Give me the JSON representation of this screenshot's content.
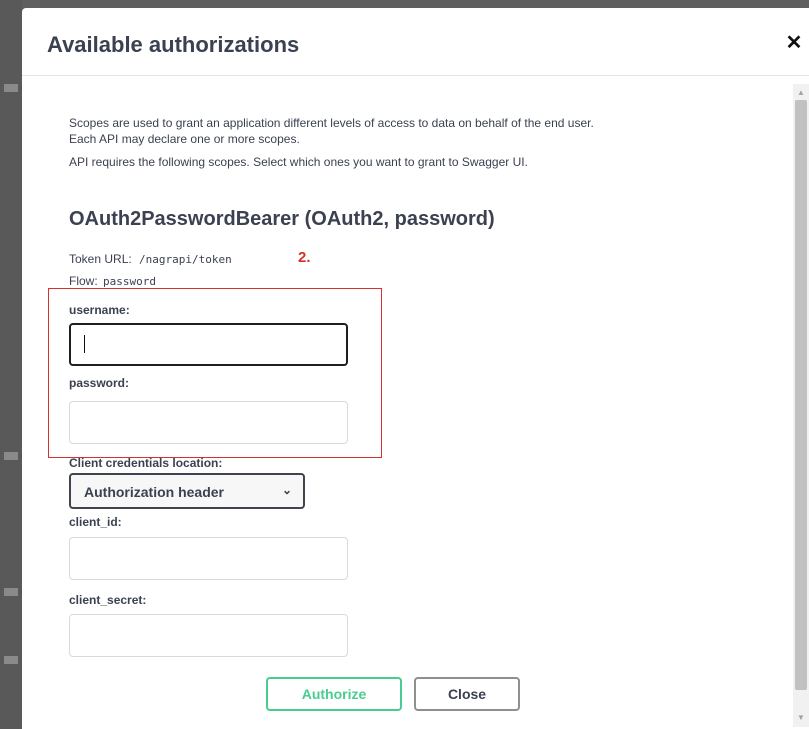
{
  "modal": {
    "title": "Available authorizations",
    "close_icon": "close-x-icon"
  },
  "description": {
    "line1": "Scopes are used to grant an application different levels of access to data on behalf of the end user.",
    "line2": "Each API may declare one or more scopes.",
    "line3": "API requires the following scopes. Select which ones you want to grant to Swagger UI."
  },
  "scheme": {
    "title": "OAuth2PasswordBearer (OAuth2, password)",
    "token_url_label": "Token URL:",
    "token_url_value": "/nagrapi/token",
    "flow_label": "Flow:",
    "flow_value": "password"
  },
  "annotation": {
    "number": "2.",
    "color": "#d3322e"
  },
  "fields": {
    "username_label": "username:",
    "username_value": "",
    "password_label": "password:",
    "password_value": "",
    "client_credentials_label": "Client credentials location:",
    "client_credentials_value": "Authorization header",
    "client_id_label": "client_id:",
    "client_id_value": "",
    "client_secret_label": "client_secret:",
    "client_secret_value": ""
  },
  "buttons": {
    "authorize": "Authorize",
    "close": "Close"
  },
  "colors": {
    "authorize": "#49cc90",
    "text": "#3b4151"
  }
}
